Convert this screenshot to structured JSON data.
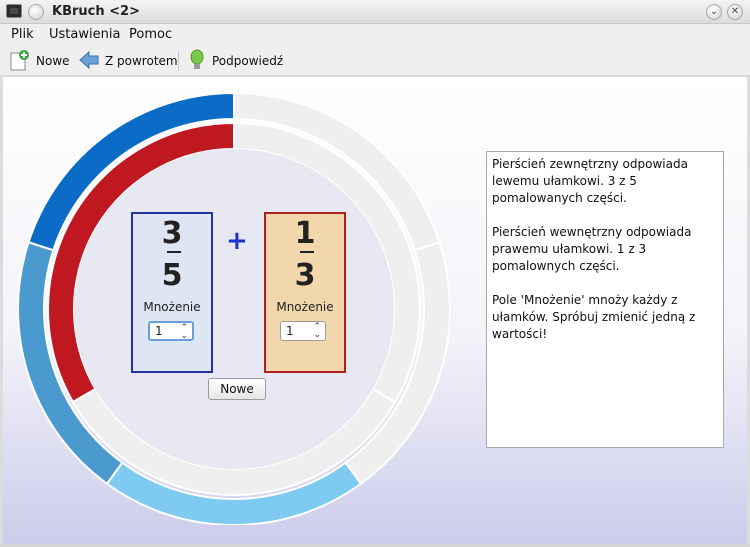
{
  "window": {
    "title": "KBruch <2>"
  },
  "menu": {
    "items": [
      "Plik",
      "Ustawienia",
      "Pomoc"
    ]
  },
  "toolbar": {
    "new_label": "Nowe",
    "back_label": "Z powrotem",
    "hint_label": "Podpowiedź"
  },
  "task": {
    "operator": "+",
    "left": {
      "numerator": "3",
      "denominator": "5",
      "operation_label": "Mnożenie",
      "multiplier": "1"
    },
    "right": {
      "numerator": "1",
      "denominator": "3",
      "operation_label": "Mnożenie",
      "multiplier": "1"
    },
    "new_button": "Nowe"
  },
  "rings": {
    "outer": {
      "parts": 5,
      "painted": 3,
      "colors": [
        "#0b6cc8",
        "#4a9ad0",
        "#7fcaf0"
      ],
      "empty_color": "#efefef"
    },
    "inner": {
      "parts": 3,
      "painted": 1,
      "color": "#bf1820",
      "empty_color": "#efefef"
    }
  },
  "info": {
    "paragraphs": [
      "Pierścień zewnętrzny odpowiada lewemu ułamkowi. 3 z 5 pomalowanych części.",
      "Pierścień wewnętrzny odpowiada prawemu ułamkowi. 1 z 3 pomalownych części.",
      "Pole 'Mnożenie' mnoży każdy z ułamków. Spróbuj zmienić jedną z wartości!"
    ]
  }
}
